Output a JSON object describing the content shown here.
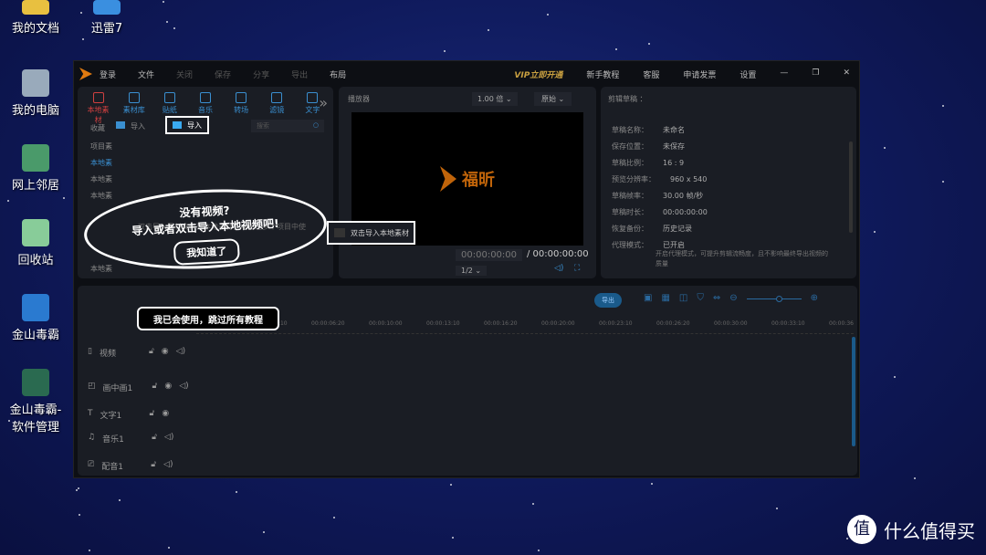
{
  "desktop": {
    "icons": [
      "我的文档",
      "迅雷7",
      "我的电脑",
      "网上邻居",
      "回收站",
      "金山毒霸",
      "金山毒霸-软件管理"
    ]
  },
  "menu": {
    "login": "登录",
    "items": [
      "文件",
      "关闭",
      "保存",
      "分享",
      "导出",
      "布局"
    ],
    "vip": "VIP立即开通",
    "right": [
      "新手教程",
      "客服",
      "申请发票",
      "设置"
    ]
  },
  "toolbar": [
    "本地素材",
    "素材库",
    "贴纸",
    "音乐",
    "转场",
    "滤镜",
    "文字"
  ],
  "media": {
    "fav": "收藏",
    "import": "导入",
    "import_highlight": "导入",
    "search_placeholder": "搜索",
    "side": [
      "项目素",
      "本地素",
      "本地素",
      "本地素",
      "本地素"
    ],
    "hint": "双击导入素材文件到本地素材，以便在多个项目中使"
  },
  "player": {
    "title": "播放器",
    "speed": "1.00 倍",
    "ratio": "原始",
    "brand": "福昕",
    "time": "00:00:00:00",
    "total": "/ 00:00:00:00",
    "page": "1/2"
  },
  "draft": {
    "title": "剪辑草稿 ：",
    "rows": [
      [
        "草稿名称：",
        "未命名"
      ],
      [
        "保存位置：",
        "未保存"
      ],
      [
        "草稿比例：",
        "16 : 9"
      ],
      [
        "预览分辨率：",
        "960 x 540"
      ],
      [
        "草稿帧率：",
        "30.00 帧/秒"
      ],
      [
        "草稿时长：",
        "00:00:00:00"
      ],
      [
        "恢复备份：",
        "历史记录"
      ],
      [
        "代理模式：",
        "已开启"
      ]
    ],
    "proxy_note": "开启代理模式，可提升剪辑流畅度，且不影响最终导出视频的质量"
  },
  "tutorial": {
    "line1": "没有视频?",
    "line2": "导入或者双击导入本地视频吧!",
    "ok": "我知道了",
    "skip": "我已会使用，跳过所有教程",
    "import_tip": "双击导入本地素材"
  },
  "timeline": {
    "export": "导出",
    "ticks": [
      "00:00:03:10",
      "00:00:06:20",
      "00:00:10:00",
      "00:00:13:10",
      "00:00:16:20",
      "00:00:20:00",
      "00:00:23:10",
      "00:00:26:20",
      "00:00:30:00",
      "00:00:33:10",
      "00:00:36"
    ],
    "tracks": [
      "视频",
      "画中画1",
      "文字1",
      "音乐1",
      "配音1"
    ]
  },
  "watermark": "什么值得买"
}
